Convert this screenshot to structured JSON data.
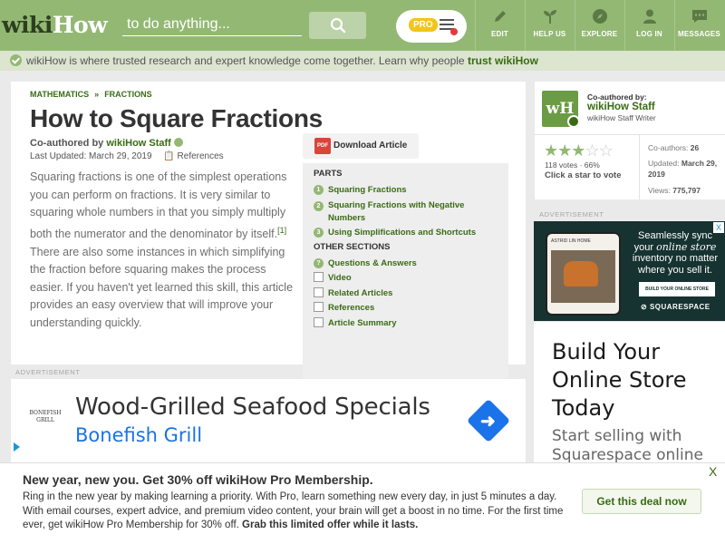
{
  "header": {
    "logo_part1": "wiki",
    "logo_part2": "How",
    "search_placeholder": "to do anything...",
    "pro_badge": "PRO",
    "nav": [
      {
        "label": "EDIT",
        "icon": "pencil-icon"
      },
      {
        "label": "HELP US",
        "icon": "sprout-icon"
      },
      {
        "label": "EXPLORE",
        "icon": "compass-icon"
      },
      {
        "label": "LOG IN",
        "icon": "user-icon"
      },
      {
        "label": "MESSAGES",
        "icon": "chat-icon"
      }
    ]
  },
  "trust_bar": {
    "text": "wikiHow is where trusted research and expert knowledge come together. Learn why people",
    "link": "trust wikiHow"
  },
  "article": {
    "breadcrumb": [
      "MATHEMATICS",
      "»",
      "FRACTIONS"
    ],
    "title": "How to Square Fractions",
    "coauthored_label": "Co-authored by",
    "author": "wikiHow Staff",
    "updated": "Last Updated: March 29, 2019",
    "references_label": "References",
    "intro_part1": "Squaring fractions is one of the simplest operations you can perform on fractions. It is very similar to squaring whole numbers in that you simply multiply both the numerator and the denominator by itself.",
    "intro_citation": "[1]",
    "intro_part2": "There are also some instances in which simplifying the fraction before squaring makes the process easier. If you haven't yet learned this skill, this article provides an easy overview that will improve your understanding quickly."
  },
  "download": {
    "icon_text": "PDF",
    "label": "Download Article"
  },
  "toc": {
    "parts_heading": "PARTS",
    "parts": [
      {
        "num": "1",
        "label": "Squaring Fractions"
      },
      {
        "num": "2",
        "label": "Squaring Fractions with Negative Numbers"
      },
      {
        "num": "3",
        "label": "Using Simplifications and Shortcuts"
      }
    ],
    "other_heading": "OTHER SECTIONS",
    "other": [
      {
        "num": "?",
        "label": "Questions & Answers"
      },
      {
        "label": "Video"
      },
      {
        "label": "Related Articles"
      },
      {
        "label": "References"
      },
      {
        "label": "Article Summary"
      }
    ]
  },
  "ads": {
    "label": "ADVERTISEMENT",
    "left": {
      "logo": "BONEFISH GRILL",
      "headline": "Wood-Grilled Seafood Specials",
      "brand": "Bonefish Grill"
    },
    "right_top": {
      "phone_text": "ASTRID LIN HOME",
      "copy_1": "Seamlessly sync your",
      "copy_italic": "online store",
      "copy_2": "inventory no matter where you sell it.",
      "cta": "BUILD YOUR ONLINE STORE",
      "brand": "SQUARESPACE",
      "close": "X"
    },
    "right_bottom": {
      "headline": "Build Your Online Store Today",
      "sub": "Start selling with Squarespace online"
    }
  },
  "sidebox": {
    "coauthored_by": "Co-authored by:",
    "name": "wikiHow Staff",
    "role": "wikiHow Staff Writer",
    "avatar": "wH",
    "votes": "118 votes · 66%",
    "vote_cta": "Click a star to vote",
    "rating": 0.66,
    "coauthors_label": "Co-authors:",
    "coauthors": "26",
    "updated_label": "Updated:",
    "updated": "March 29, 2019",
    "views_label": "Views:",
    "views": "775,797"
  },
  "promo": {
    "heading": "New year, new you. Get 30% off wikiHow Pro Membership.",
    "body": "Ring in the new year by making learning a priority. With Pro, learn something new every day, in just 5 minutes a day. With email courses, expert advice, and premium video content, your brain will get a boost in no time. For the first time ever, get wikiHow Pro Membership for 30% off.",
    "body_bold": "Grab this limited offer while it lasts.",
    "cta": "Get this deal now",
    "close": "X"
  },
  "colors": {
    "brand_green": "#93b874",
    "link_green": "#3a6b14"
  }
}
